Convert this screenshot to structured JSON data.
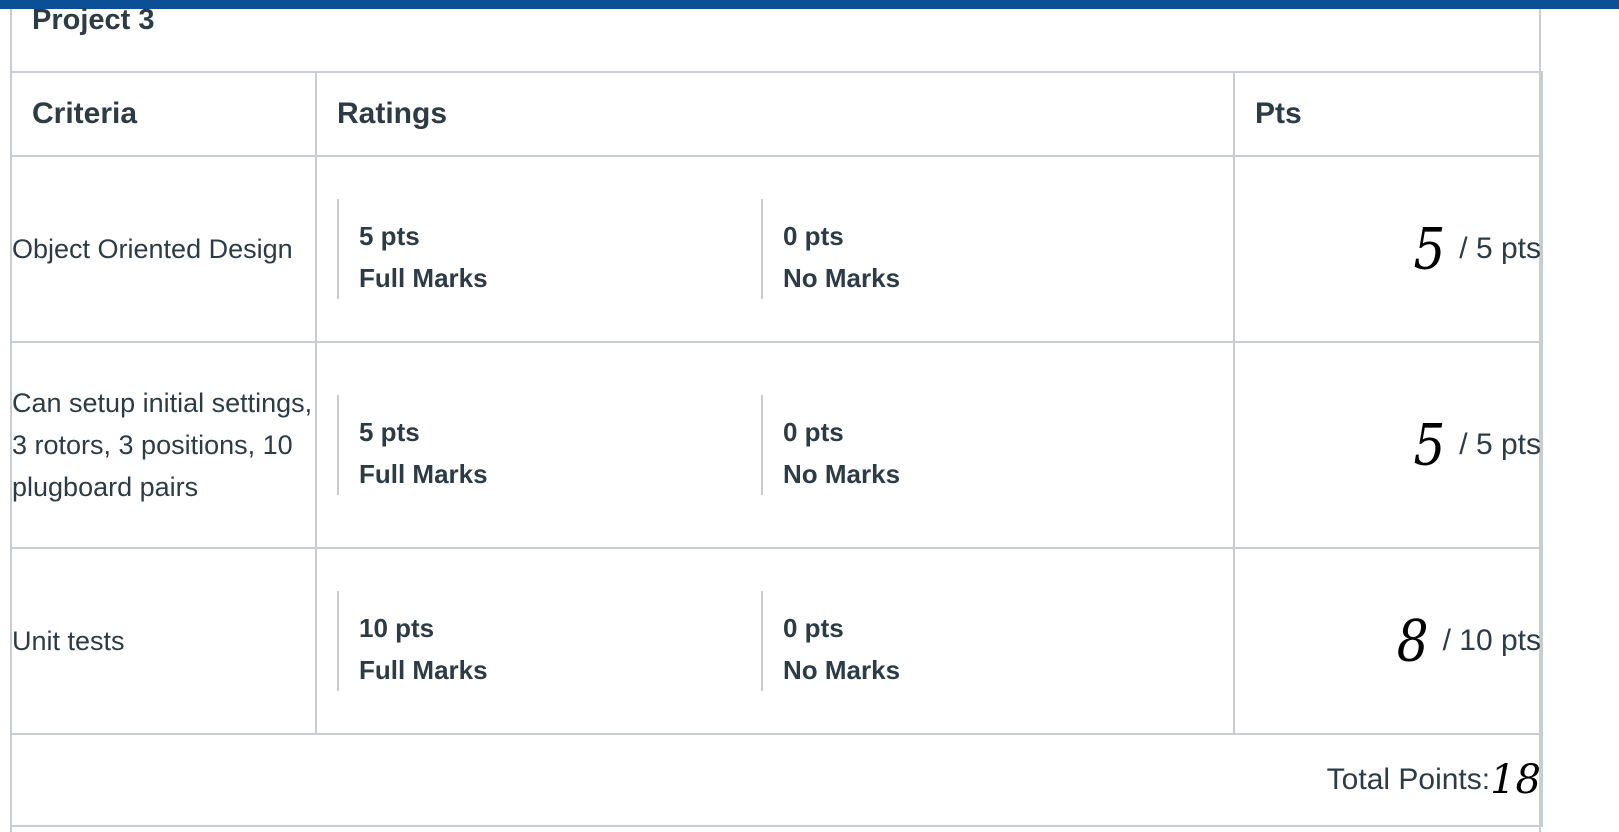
{
  "rubric": {
    "title": "Project 3",
    "headers": {
      "criteria": "Criteria",
      "ratings": "Ratings",
      "pts": "Pts"
    },
    "rows": [
      {
        "criterion": "Object Oriented Design",
        "ratings": [
          {
            "points": "5 pts",
            "label": "Full Marks"
          },
          {
            "points": "0 pts",
            "label": "No Marks"
          }
        ],
        "handwritten_score": "5",
        "out_of": "/ 5 pts"
      },
      {
        "criterion": "Can setup initial settings, 3 rotors, 3 positions, 10 plugboard pairs",
        "ratings": [
          {
            "points": "5 pts",
            "label": "Full Marks"
          },
          {
            "points": "0 pts",
            "label": "No Marks"
          }
        ],
        "handwritten_score": "5",
        "out_of": "/ 5 pts"
      },
      {
        "criterion": "Unit tests",
        "ratings": [
          {
            "points": "10 pts",
            "label": "Full Marks"
          },
          {
            "points": "0 pts",
            "label": "No Marks"
          }
        ],
        "handwritten_score": "8",
        "out_of": "/ 10 pts"
      }
    ],
    "total_label": "Total Points:",
    "total_handwritten": "18"
  },
  "colors": {
    "topbar": "#0b4f96",
    "text": "#2d3b45",
    "border": "#c7cdd1"
  }
}
